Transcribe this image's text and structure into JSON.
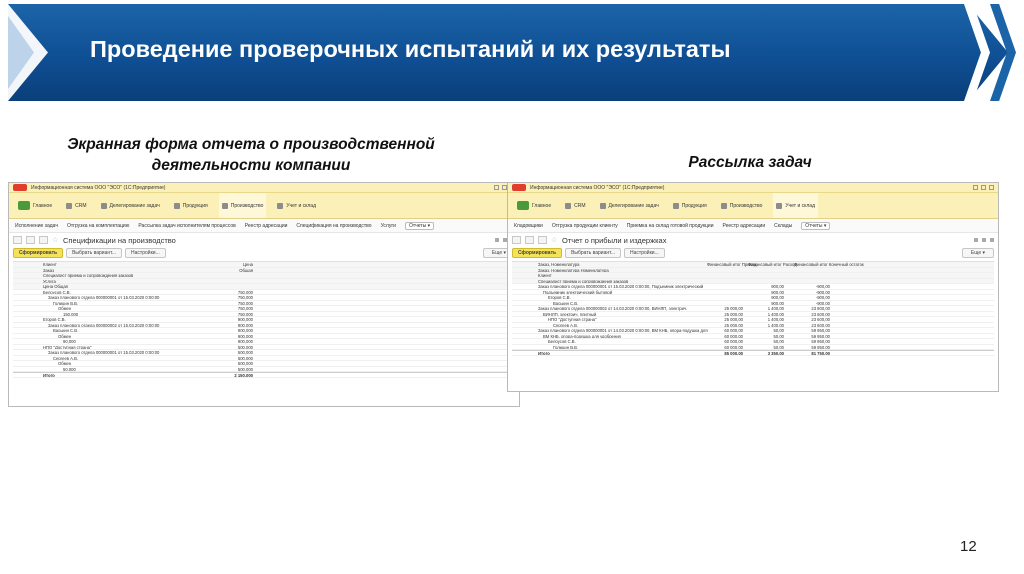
{
  "slide": {
    "title": "Проведение проверочных испытаний и их результаты",
    "page_number": "12"
  },
  "captions": {
    "left_line1": "Экранная форма отчета о производственной",
    "left_line2": "деятельности компании",
    "right": "Рассылка задач"
  },
  "left_window": {
    "title_bar": "Информационная система ООО \"ЭСО\" (1С:Предприятие)",
    "sections": [
      {
        "label": "Главное",
        "active": false
      },
      {
        "label": "CRM",
        "active": false
      },
      {
        "label": "Делегирование задач",
        "active": false
      },
      {
        "label": "Продукция",
        "active": false
      },
      {
        "label": "Производство",
        "active": true
      },
      {
        "label": "Учет и склад",
        "active": false
      }
    ],
    "menu": [
      "Исполнение задач",
      "Отгрузка на комплектацию",
      "Рассылка задач исполнителям процессов",
      "Реестр адресации",
      "Спецификация на производство",
      "Услуги"
    ],
    "menu_button": "Отчеты ▾",
    "form_title": "Спецификации на производство",
    "toolbar": {
      "generate": "Сформировать",
      "choose": "Выбрать вариант...",
      "settings": "Настройки...",
      "more": "Еще ▾"
    },
    "report": {
      "headers": [
        {
          "text": "Клиент",
          "num": "Цена"
        },
        {
          "text": "Заказ",
          "num": "Общая"
        },
        {
          "text": "Специалист приема и сопровождения заказов",
          "num": ""
        },
        {
          "text": "Услуга",
          "num": ""
        },
        {
          "text": "Цена Общая",
          "num": ""
        }
      ],
      "rows": [
        {
          "text": "Белоусов С.В.",
          "num": "750,000",
          "indent": 0
        },
        {
          "text": "Заказ планового отдела 000000001 от 15.03.2020 0:00:00",
          "num": "750,000",
          "indent": 1
        },
        {
          "text": "Голицин В.В.",
          "num": "750,000",
          "indent": 2
        },
        {
          "text": "Обмен",
          "num": "750,000",
          "indent": 3
        },
        {
          "text": "150,000",
          "num": "750,000",
          "indent": 4
        },
        {
          "text": "Егоров С.В.",
          "num": "900,000",
          "indent": 0
        },
        {
          "text": "Заказ планового отдела 000000002 от 15.03.2020 0:00:00",
          "num": "900,000",
          "indent": 1
        },
        {
          "text": "Васькин С.В.",
          "num": "900,000",
          "indent": 2
        },
        {
          "text": "Обмен",
          "num": "900,000",
          "indent": 3
        },
        {
          "text": "90,000",
          "num": "900,000",
          "indent": 4
        },
        {
          "text": "НПО \"Доступная страна\"",
          "num": "500,000",
          "indent": 0
        },
        {
          "text": "Заказ планового отдела 000000001 от 15.03.2020 0:00:00",
          "num": "500,000",
          "indent": 1
        },
        {
          "text": "Сергеев А.В.",
          "num": "500,000",
          "indent": 2
        },
        {
          "text": "Обмен",
          "num": "500,000",
          "indent": 3
        },
        {
          "text": "50,000",
          "num": "500,000",
          "indent": 4
        }
      ],
      "total": {
        "text": "Итого",
        "num": "2 150,000"
      }
    }
  },
  "right_window": {
    "title_bar": "Информационная система ООО \"ЭСО\" (1С:Предприятие)",
    "sections": [
      {
        "label": "Главное",
        "active": false
      },
      {
        "label": "CRM",
        "active": false
      },
      {
        "label": "Делегирование задач",
        "active": false
      },
      {
        "label": "Продукция",
        "active": false
      },
      {
        "label": "Производство",
        "active": false
      },
      {
        "label": "Учет и склад",
        "active": true
      }
    ],
    "menu": [
      "Кладовщики",
      "Отгрузка продукции клиенту",
      "Приемка на склад готовой продукции",
      "Реестр адресации",
      "Склады"
    ],
    "menu_button": "Отчеты ▾",
    "form_title": "Отчет о прибыли и издержках",
    "toolbar": {
      "generate": "Сформировать",
      "choose": "Выбрать вариант...",
      "settings": "Настройки...",
      "more": "Еще ▾"
    },
    "report": {
      "headers": [
        {
          "text": "Заказ, Номенклатура",
          "c1": "Финансовый итог Приход",
          "c2": "Финансовый итог Расход",
          "c3": "Финансовый итог Конечный остаток"
        },
        {
          "text": "Заказ, Номенклатура Номенклатура",
          "c1": "",
          "c2": "",
          "c3": ""
        },
        {
          "text": "Клиент",
          "c1": "",
          "c2": "",
          "c3": ""
        },
        {
          "text": "Специалист приема и сопровождения заказов",
          "c1": "",
          "c2": "",
          "c3": ""
        }
      ],
      "rows": [
        {
          "text": "Заказ планового отдела 000000001 от 15.03.2020 0:00:00, Подъемник электрический",
          "c1": "",
          "c2": "900,00",
          "c3": "-900,00",
          "indent": 0
        },
        {
          "text": "Подъемник электрический бытовой",
          "c1": "",
          "c2": "900,00",
          "c3": "-900,00",
          "indent": 1
        },
        {
          "text": "Егоров С.В.",
          "c1": "",
          "c2": "900,00",
          "c3": "-900,00",
          "indent": 2
        },
        {
          "text": "Васькин С.В.",
          "c1": "",
          "c2": "900,00",
          "c3": "-900,00",
          "indent": 3
        },
        {
          "text": "Заказ планового отдела 000000002 от 14.03.2020 0:00:00, ВИНЛП, электрич.",
          "c1": "25 000,00",
          "c2": "1 400,00",
          "c3": "23 600,00",
          "indent": 0
        },
        {
          "text": "ВИНЛП, электрич. плитный",
          "c1": "25 000,00",
          "c2": "1 400,00",
          "c3": "23 600,00",
          "indent": 1
        },
        {
          "text": "НПО \"Доступная страна\"",
          "c1": "25 000,00",
          "c2": "1 400,00",
          "c3": "23 600,00",
          "indent": 2
        },
        {
          "text": "Сергеев А.В.",
          "c1": "25 000,00",
          "c2": "1 400,00",
          "c3": "23 600,00",
          "indent": 3
        },
        {
          "text": "Заказ планового отдела 000000001 от 14.03.2020 0:00:00, ВМ КНБ, опора-подушка для",
          "c1": "60 000,00",
          "c2": "50,00",
          "c3": "59 950,00",
          "indent": 0
        },
        {
          "text": "ВМ КНБ, опора-подушка для удобрения",
          "c1": "60 000,00",
          "c2": "50,00",
          "c3": "59 950,00",
          "indent": 1
        },
        {
          "text": "Белоусов С.В.",
          "c1": "60 000,00",
          "c2": "50,00",
          "c3": "59 950,00",
          "indent": 2
        },
        {
          "text": "Голицин В.В.",
          "c1": "60 000,00",
          "c2": "50,00",
          "c3": "59 950,00",
          "indent": 3
        }
      ],
      "total": {
        "text": "Итого",
        "c1": "85 000,00",
        "c2": "3 350,00",
        "c3": "81 750,00"
      }
    }
  }
}
